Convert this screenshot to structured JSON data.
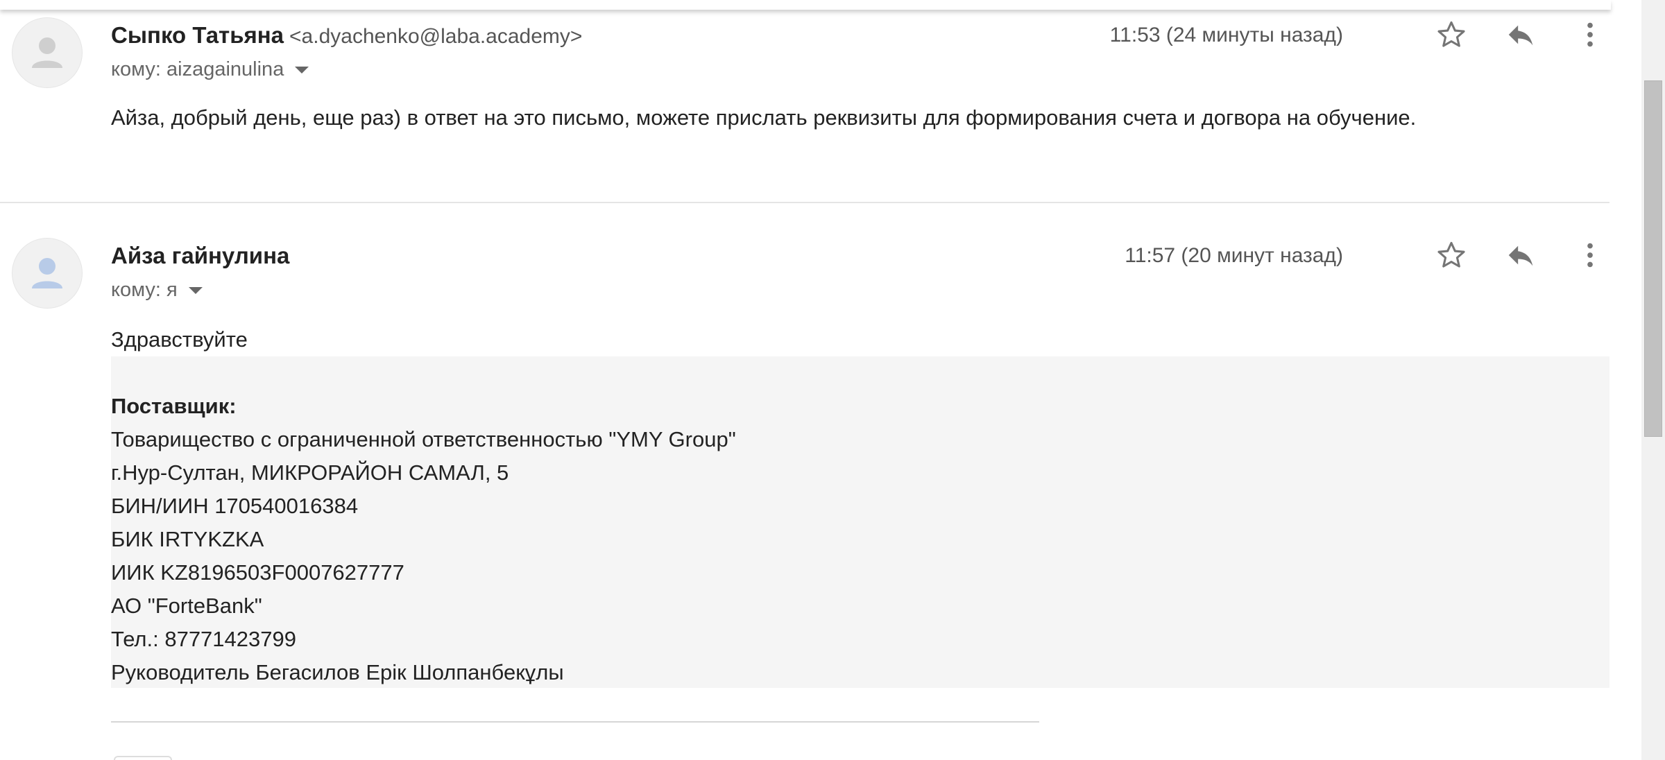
{
  "messages": [
    {
      "sender_name": "Сыпко Татьяна",
      "sender_email": "<a.dyachenko@laba.academy>",
      "recipient": "кому: aizagainulina",
      "time": "11:53 (24 минуты назад)",
      "body": "Айза, добрый день, еще раз) в ответ на это письмо, можете прислать реквизиты для формирования счета и догвора на обучение.",
      "avatar_color": "#cfcfcf"
    },
    {
      "sender_name": "Айза гайнулина",
      "recipient": "кому: я",
      "time": "11:57 (20 минут назад)",
      "greeting": "Здравствуйте",
      "avatar_color": "#b8cbe8",
      "details": {
        "heading": "Поставщик:",
        "lines": [
          "Товарищество с ограниченной ответственностью \"YMY Group\"",
          "г.Нур-Султан, МИКРОРАЙОН САМАЛ, 5",
          "БИН/ИИН 170540016384",
          "БИК IRTYKZKA",
          "ИИК KZ8196503F0007627777",
          "АО \"ForteBank\"",
          "Тел.: 87771423799",
          "Руководитель Бегасилов Ерік Шолпанбекұлы"
        ]
      }
    }
  ],
  "icons": {
    "star": "star-icon",
    "reply": "reply-icon",
    "more": "more-vert-icon"
  },
  "colors": {
    "icon": "#757575",
    "quote_background": "#f5f5f5"
  }
}
